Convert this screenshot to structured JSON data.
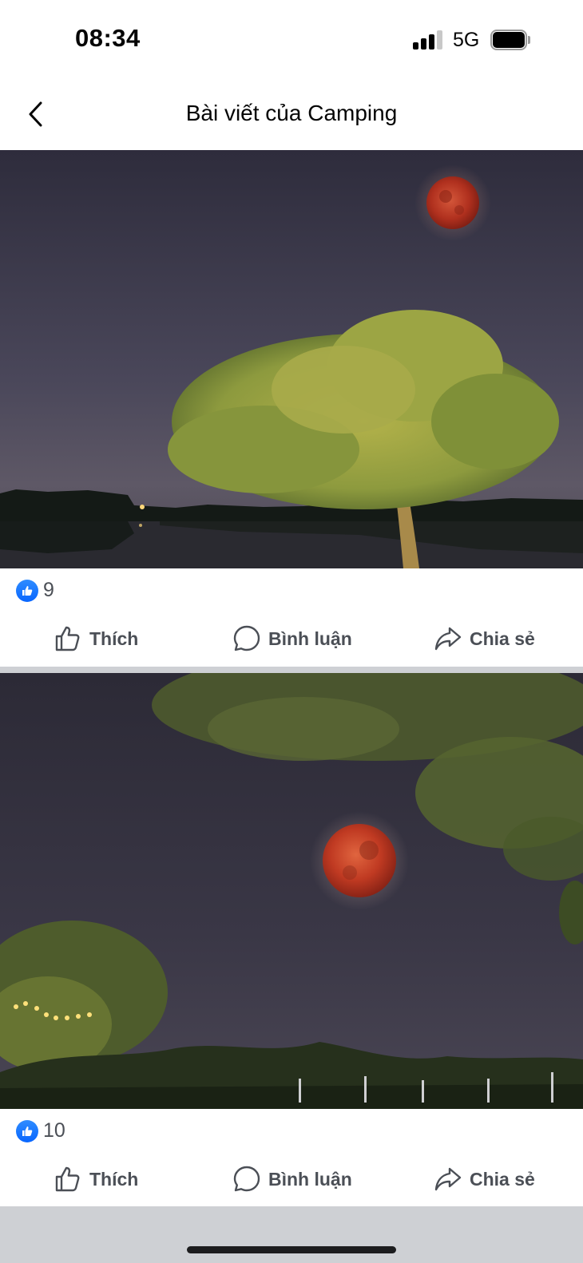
{
  "status_bar": {
    "time": "08:34",
    "network": "5G",
    "signal_bars_active": 3,
    "signal_bars_total": 4,
    "battery_level": 1.0
  },
  "header": {
    "back_icon": "chevron-left-icon",
    "title": "Bài viết của Camping"
  },
  "posts": [
    {
      "photo_description_icon": "photo",
      "reaction_icon": "thumbs-up-icon",
      "reaction_count": "9",
      "actions": [
        {
          "icon": "thumbs-up-outline-icon",
          "label": "Thích"
        },
        {
          "icon": "comment-bubble-icon",
          "label": "Bình luận"
        },
        {
          "icon": "share-arrow-icon",
          "label": "Chia sẻ"
        }
      ]
    },
    {
      "photo_description_icon": "photo",
      "reaction_icon": "thumbs-up-icon",
      "reaction_count": "10",
      "actions": [
        {
          "icon": "thumbs-up-outline-icon",
          "label": "Thích"
        },
        {
          "icon": "comment-bubble-icon",
          "label": "Bình luận"
        },
        {
          "icon": "share-arrow-icon",
          "label": "Chia sẻ"
        }
      ]
    }
  ],
  "colors": {
    "accent": "#0866ff",
    "action_text": "#4b4f56",
    "separator": "#ced0d4",
    "night_sky": "#3a3848",
    "moon": "#b8301e"
  }
}
